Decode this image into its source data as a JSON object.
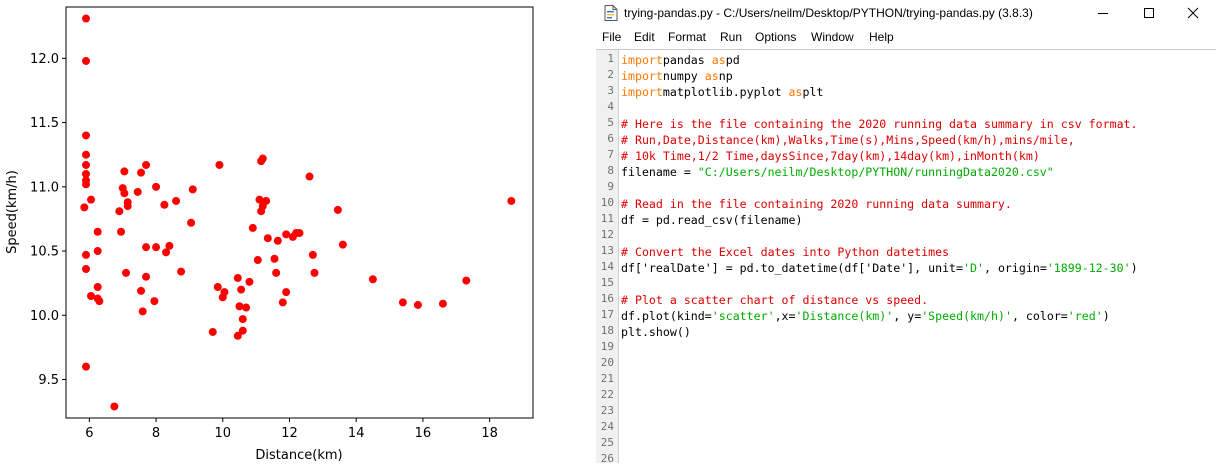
{
  "colors": {
    "marker": "#ff0000",
    "keyword": "#ff7700",
    "comment": "#dd0000",
    "string": "#00aa00",
    "gutter_bg": "#f0f0f0"
  },
  "plot": {
    "xlabel": "Distance(km)",
    "ylabel": "Speed(km/h)"
  },
  "chart_data": {
    "type": "scatter",
    "title": "",
    "xlabel": "Distance(km)",
    "ylabel": "Speed(km/h)",
    "xlim": [
      5.3,
      19.3
    ],
    "ylim": [
      9.2,
      12.4
    ],
    "x_ticks": [
      6,
      8,
      10,
      12,
      14,
      16,
      18
    ],
    "y_ticks": [
      9.5,
      10.0,
      10.5,
      11.0,
      11.5,
      12.0
    ],
    "x_tick_labels": [
      "6",
      "8",
      "10",
      "12",
      "14",
      "16",
      "18"
    ],
    "y_tick_labels": [
      "9.5",
      "10.0",
      "10.5",
      "11.0",
      "11.5",
      "12.0"
    ],
    "grid": false,
    "legend": "none",
    "marker_color": "red",
    "points": [
      [
        5.9,
        12.31
      ],
      [
        5.9,
        11.98
      ],
      [
        5.9,
        11.4
      ],
      [
        5.9,
        11.25
      ],
      [
        5.9,
        11.17
      ],
      [
        5.9,
        11.1
      ],
      [
        5.9,
        11.05
      ],
      [
        5.9,
        11.02
      ],
      [
        5.85,
        10.84
      ],
      [
        6.05,
        10.9
      ],
      [
        5.9,
        10.47
      ],
      [
        5.9,
        10.36
      ],
      [
        6.05,
        10.15
      ],
      [
        5.9,
        9.6
      ],
      [
        6.25,
        10.65
      ],
      [
        6.25,
        10.5
      ],
      [
        6.25,
        10.22
      ],
      [
        6.25,
        10.13
      ],
      [
        6.3,
        10.11
      ],
      [
        6.75,
        9.29
      ],
      [
        6.9,
        10.81
      ],
      [
        6.95,
        10.65
      ],
      [
        7.0,
        10.99
      ],
      [
        7.05,
        11.12
      ],
      [
        7.05,
        10.95
      ],
      [
        7.1,
        10.33
      ],
      [
        7.15,
        10.88
      ],
      [
        7.15,
        10.85
      ],
      [
        7.45,
        10.96
      ],
      [
        7.55,
        11.11
      ],
      [
        7.55,
        10.19
      ],
      [
        7.6,
        10.03
      ],
      [
        7.7,
        11.17
      ],
      [
        7.7,
        10.53
      ],
      [
        7.7,
        10.3
      ],
      [
        7.95,
        10.11
      ],
      [
        8.0,
        11.0
      ],
      [
        8.0,
        10.53
      ],
      [
        8.25,
        10.86
      ],
      [
        8.3,
        10.49
      ],
      [
        8.4,
        10.54
      ],
      [
        8.6,
        10.89
      ],
      [
        8.75,
        10.34
      ],
      [
        9.05,
        10.72
      ],
      [
        9.1,
        10.98
      ],
      [
        9.7,
        9.87
      ],
      [
        9.85,
        10.22
      ],
      [
        9.9,
        11.17
      ],
      [
        10.0,
        10.14
      ],
      [
        10.05,
        10.18
      ],
      [
        10.45,
        10.29
      ],
      [
        10.45,
        9.84
      ],
      [
        10.5,
        10.07
      ],
      [
        10.55,
        10.2
      ],
      [
        10.6,
        9.97
      ],
      [
        10.6,
        9.88
      ],
      [
        10.7,
        10.06
      ],
      [
        10.8,
        10.26
      ],
      [
        10.9,
        10.68
      ],
      [
        11.05,
        10.43
      ],
      [
        11.1,
        10.9
      ],
      [
        11.15,
        11.2
      ],
      [
        11.15,
        10.81
      ],
      [
        11.2,
        11.22
      ],
      [
        11.2,
        10.85
      ],
      [
        11.3,
        10.89
      ],
      [
        11.35,
        10.6
      ],
      [
        11.55,
        10.44
      ],
      [
        11.6,
        10.33
      ],
      [
        11.65,
        10.58
      ],
      [
        11.8,
        10.1
      ],
      [
        11.9,
        10.63
      ],
      [
        11.9,
        10.18
      ],
      [
        12.1,
        10.61
      ],
      [
        12.2,
        10.64
      ],
      [
        12.3,
        10.64
      ],
      [
        12.6,
        11.08
      ],
      [
        12.7,
        10.47
      ],
      [
        12.75,
        10.33
      ],
      [
        13.45,
        10.82
      ],
      [
        13.6,
        10.55
      ],
      [
        14.5,
        10.28
      ],
      [
        15.4,
        10.1
      ],
      [
        15.85,
        10.08
      ],
      [
        16.6,
        10.09
      ],
      [
        17.3,
        10.27
      ],
      [
        18.65,
        10.89
      ]
    ]
  },
  "editor": {
    "app_icon": "idle-file-icon",
    "title": "trying-pandas.py - C:/Users/neilm/Desktop/PYTHON/trying-pandas.py (3.8.3)",
    "window_buttons": {
      "minimize": "minimize-icon",
      "maximize": "maximize-icon",
      "close": "close-icon"
    },
    "menu": [
      "File",
      "Edit",
      "Format",
      "Run",
      "Options",
      "Window",
      "Help"
    ],
    "line_numbers": [
      "1",
      "2",
      "3",
      "4",
      "5",
      "6",
      "7",
      "8",
      "9",
      "10",
      "11",
      "12",
      "13",
      "14",
      "15",
      "16",
      "17",
      "18",
      "19",
      "20",
      "21",
      "22",
      "23",
      "24",
      "25",
      "26"
    ],
    "lines": [
      [
        [
          "kw",
          "import"
        ],
        [
          "",
          "pandas "
        ],
        [
          "kw",
          "as"
        ],
        [
          "",
          "pd"
        ]
      ],
      [
        [
          "kw",
          "import"
        ],
        [
          "",
          "numpy "
        ],
        [
          "kw",
          "as"
        ],
        [
          "",
          "np"
        ]
      ],
      [
        [
          "kw",
          "import"
        ],
        [
          "",
          "matplotlib.pyplot "
        ],
        [
          "kw",
          "as"
        ],
        [
          "",
          "plt"
        ]
      ],
      [],
      [
        [
          "cm",
          "# Here is the file containing the 2020 running data summary in csv format."
        ]
      ],
      [
        [
          "cm",
          "# Run,Date,Distance(km),Walks,Time(s),Mins,Speed(km/h),mins/mile,"
        ]
      ],
      [
        [
          "cm",
          "# 10k Time,1/2 Time,daysSince,7day(km),14day(km),inMonth(km)"
        ]
      ],
      [
        [
          "",
          "filename = "
        ],
        [
          "st",
          "\"C:/Users/neilm/Desktop/PYTHON/runningData2020.csv\""
        ]
      ],
      [],
      [
        [
          "cm",
          "# Read in the file containing 2020 running data summary."
        ]
      ],
      [
        [
          "",
          "df = pd.read_csv(filename)"
        ]
      ],
      [],
      [
        [
          "cm",
          "# Convert the Excel dates into Python datetimes"
        ]
      ],
      [
        [
          "",
          "df['realDate'] = pd.to_datetime(df['Date'], unit="
        ],
        [
          "st",
          "'D'"
        ],
        [
          "",
          ", origin="
        ],
        [
          "st",
          "'1899-12-30'"
        ],
        [
          "",
          ")"
        ]
      ],
      [],
      [
        [
          "cm",
          "# Plot a scatter chart of distance vs speed."
        ]
      ],
      [
        [
          "",
          "df.plot(kind="
        ],
        [
          "st",
          "'scatter'"
        ],
        [
          "",
          ",x="
        ],
        [
          "st",
          "'Distance(km)'"
        ],
        [
          "",
          ", y="
        ],
        [
          "st",
          "'Speed(km/h)'"
        ],
        [
          "",
          ", color="
        ],
        [
          "st",
          "'red'"
        ],
        [
          "",
          ")"
        ]
      ],
      [
        [
          "",
          "plt.show()"
        ]
      ]
    ]
  }
}
